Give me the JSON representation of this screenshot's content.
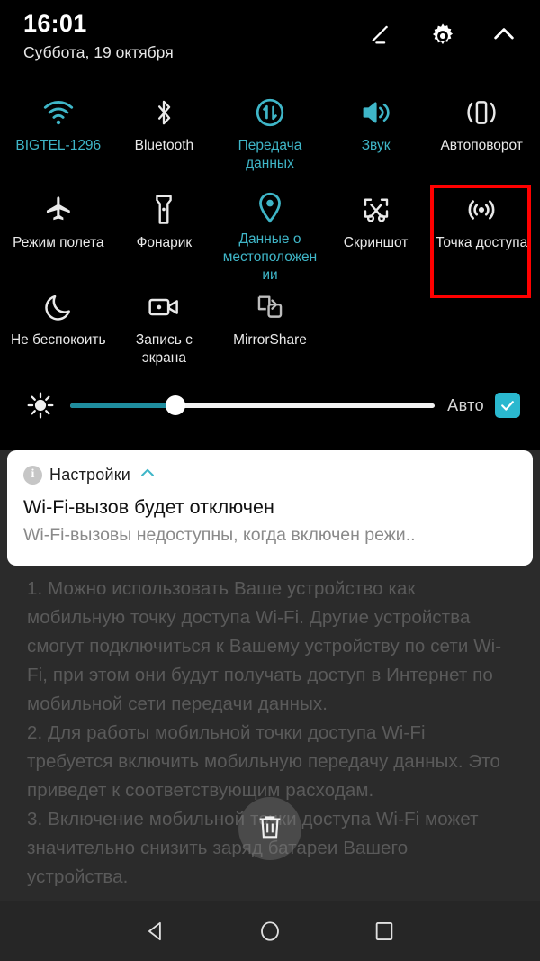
{
  "status_bar": {
    "time": "16:01",
    "date": "Суббота, 19 октября",
    "icons": [
      "edit-icon",
      "gear-icon",
      "chevron-up-icon"
    ]
  },
  "quick_settings": {
    "tiles": [
      {
        "label": "BIGTEL-1296",
        "icon": "wifi-icon",
        "active": true,
        "highlighted": false
      },
      {
        "label": "Bluetooth",
        "icon": "bluetooth-icon",
        "active": false,
        "highlighted": false
      },
      {
        "label": "Передача данных",
        "icon": "data-transfer-icon",
        "active": true,
        "highlighted": false
      },
      {
        "label": "Звук",
        "icon": "sound-icon",
        "active": true,
        "highlighted": false
      },
      {
        "label": "Автоповорот",
        "icon": "auto-rotate-icon",
        "active": false,
        "highlighted": false
      },
      {
        "label": "Режим полета",
        "icon": "airplane-icon",
        "active": false,
        "highlighted": false
      },
      {
        "label": "Фонарик",
        "icon": "flashlight-icon",
        "active": false,
        "highlighted": false
      },
      {
        "label": "Данные о местоположении",
        "icon": "location-pin-icon",
        "active": true,
        "highlighted": false
      },
      {
        "label": "Скриншот",
        "icon": "screenshot-icon",
        "active": false,
        "highlighted": false
      },
      {
        "label": "Точка доступа",
        "icon": "hotspot-icon",
        "active": false,
        "highlighted": true
      },
      {
        "label": "Не беспокоить",
        "icon": "moon-icon",
        "active": false,
        "highlighted": false
      },
      {
        "label": "Запись с экрана",
        "icon": "screen-record-icon",
        "active": false,
        "highlighted": false
      },
      {
        "label": "MirrorShare",
        "icon": "mirrorshare-icon",
        "active": false,
        "highlighted": false
      }
    ],
    "brightness": {
      "icon": "brightness-sun-icon",
      "value_percent": 29,
      "auto_label": "Авто",
      "auto_checked": true
    },
    "highlight_color": "#ff0000",
    "accent_color": "#3fb6c8"
  },
  "notification": {
    "app_name": "Настройки",
    "app_icon": "info-icon",
    "collapse_icon": "chevron-up-icon",
    "title": "Wi-Fi-вызов будет отключен",
    "body": "Wi-Fi-вызовы недоступны, когда включен режи.."
  },
  "background_content": {
    "paragraphs": [
      "1. Можно использовать Ваше устройство как мобильную точку доступа Wi-Fi. Другие устройства смогут подключиться к Вашему устройству по сети Wi-Fi, при этом они будут получать доступ в Интернет по мобильной сети передачи данных.",
      "2. Для работы мобильной точки доступа Wi-Fi требуется включить мобильную передачу данных. Это приведет к соответствующим расходам.",
      "3. Включение мобильной точки доступа Wi-Fi может значительно снизить заряд батареи Вашего устройства."
    ],
    "floating_button_icon": "trash-icon"
  },
  "nav_bar": {
    "buttons": [
      "back-icon",
      "home-icon",
      "recents-icon"
    ]
  }
}
